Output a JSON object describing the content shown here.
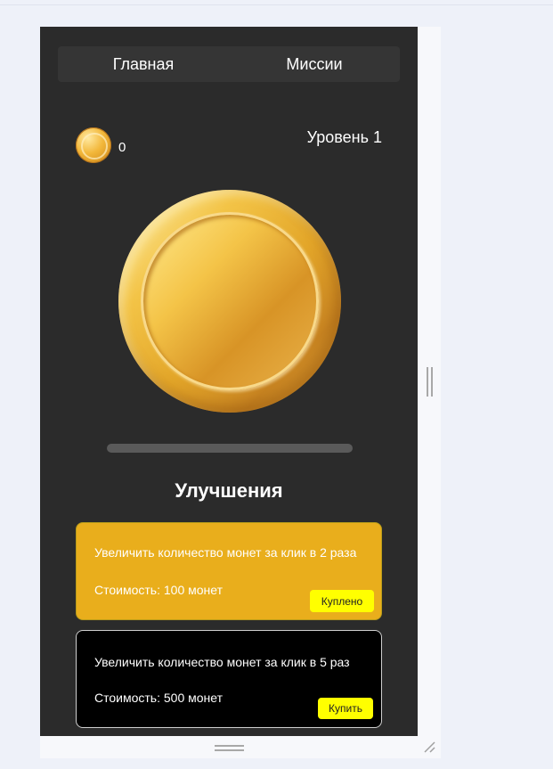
{
  "nav": {
    "tabs": [
      {
        "label": "Главная"
      },
      {
        "label": "Миссии"
      }
    ]
  },
  "balance": {
    "icon": "coin-icon",
    "value": "0"
  },
  "level": {
    "label": "Уровень 1"
  },
  "main_coin": {
    "icon": "coin-icon"
  },
  "progress": {
    "fraction": 0
  },
  "upgrades": {
    "title": "Улучшения",
    "items": [
      {
        "description": "Увеличить количество монет за клик в 2 раза",
        "cost": "Стоимость: 100 монет",
        "button": "Куплено",
        "background": "#e9ae1c"
      },
      {
        "description": "Увеличить количество монет за клик в 5 раз",
        "cost": "Стоимость: 500 монет",
        "button": "Купить",
        "background": "#000000"
      }
    ]
  },
  "colors": {
    "app_background": "#2b2b2b",
    "accent_yellow": "#ffff00",
    "gold": "#e9ae1c"
  }
}
